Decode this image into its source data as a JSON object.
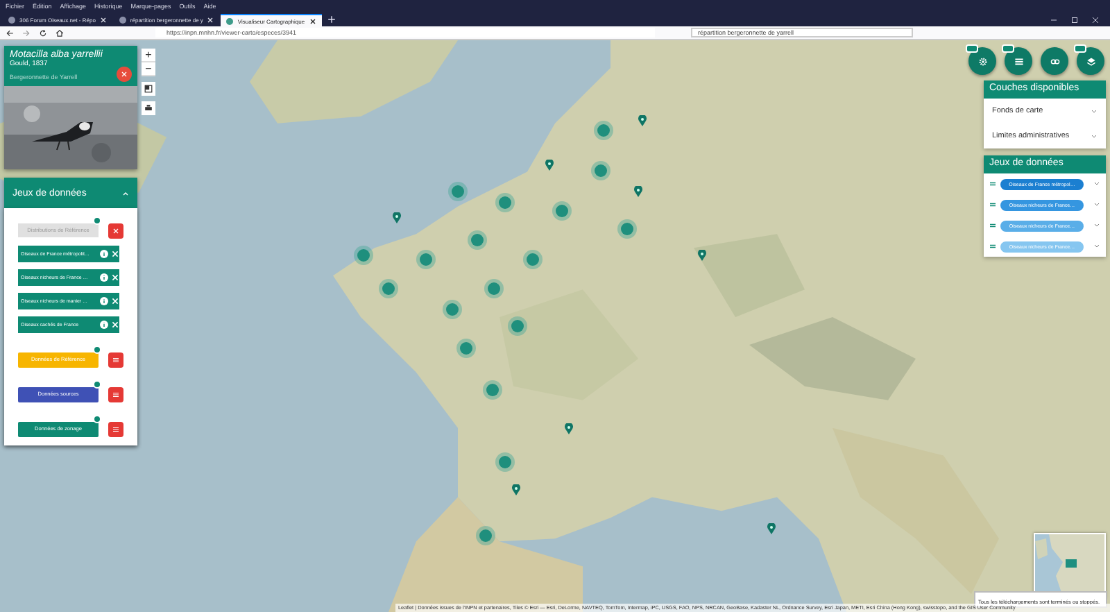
{
  "browser": {
    "menu": [
      "Fichier",
      "Édition",
      "Affichage",
      "Historique",
      "Marque-pages",
      "Outils",
      "Aide"
    ],
    "tabs": [
      {
        "title": "306 Forum Oiseaux.net - Répo",
        "selected": false
      },
      {
        "title": "répartition bergeronnette de y",
        "selected": false
      },
      {
        "title": "Visualiseur Cartographique",
        "selected": true
      }
    ],
    "url": "https://inpn.mnhn.fr/viewer-carto/especes/3941",
    "search": "répartition bergeronnette de yarrell"
  },
  "species": {
    "scientific_name": "Motacilla alba yarrellii",
    "author": "Gould, 1837",
    "common_name": "Bergeronnette de Yarrell"
  },
  "zoom_controls": [
    "+",
    "−"
  ],
  "datasets_panel": {
    "title": "Jeux de données",
    "expanded": true,
    "items": [
      {
        "kind": "reference",
        "label": "Distributions de Référence"
      },
      {
        "kind": "dataset",
        "label": "Oiseaux de France métropolit…"
      },
      {
        "kind": "dataset",
        "label": "Oiseaux nicheurs de France …"
      },
      {
        "kind": "dataset",
        "label": "Oiseaux nicheurs de manier …"
      },
      {
        "kind": "dataset",
        "label": "Oiseaux cachés de France"
      },
      {
        "kind": "group",
        "label": "Données de Référence",
        "color": "#f7b500"
      },
      {
        "kind": "group",
        "label": "Données sources",
        "color": "#3f51b5"
      },
      {
        "kind": "group",
        "label": "Données de zonage",
        "color": "#0e8a73"
      }
    ]
  },
  "layers_panel": {
    "title": "Couches disponibles",
    "items": [
      {
        "label": "Fonds de carte"
      },
      {
        "label": "Limites administratives"
      }
    ]
  },
  "legend": {
    "title": "Jeux de données",
    "items": [
      {
        "label": "Oiseaux de France métropol…",
        "color": "#1b7fd1"
      },
      {
        "label": "Oiseaux nicheurs de France…",
        "color": "#3596e0"
      },
      {
        "label": "Oiseaux nicheurs de France…",
        "color": "#5aaee8"
      },
      {
        "label": "Oiseaux nicheurs de France…",
        "color": "#86c6f0"
      }
    ]
  },
  "downloads": {
    "message": "Tous les téléchargements sont terminés ou stoppés."
  },
  "attribution": "Leaflet | Données issues de l'INPN et partenaires, Tiles © Esri — Esri, DeLorme, NAVTEQ, TomTom, Intermap, iPC, USGS, FAO, NPS, NRCAN, GeoBase, Kadaster NL, Ordnance Survey, Esri Japan, METI, Esri China (Hong Kong), swisstopo, and the GIS User Community"
}
